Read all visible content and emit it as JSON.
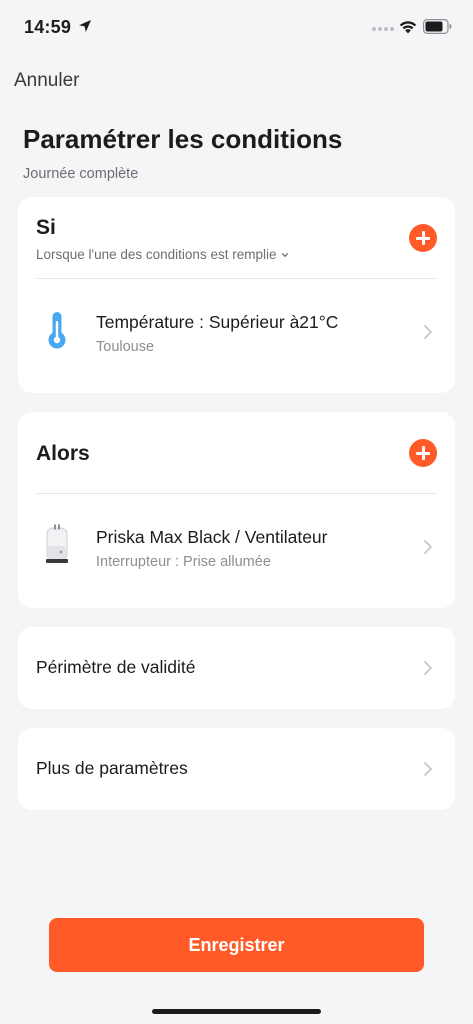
{
  "status_bar": {
    "time": "14:59",
    "icons": [
      "location-arrow-icon",
      "cellular-signal-icon",
      "wifi-icon",
      "battery-icon"
    ]
  },
  "nav": {
    "cancel_label": "Annuler"
  },
  "header": {
    "title": "Paramétrer les conditions",
    "subtitle": "Journée complète"
  },
  "if_section": {
    "title": "Si",
    "mode_label": "Lorsque l'une des conditions est remplie",
    "add_icon": "plus-circle-icon",
    "conditions": [
      {
        "title": "Température : Supérieur à21°C",
        "subtitle": "Toulouse",
        "icon": "thermometer-icon"
      }
    ]
  },
  "then_section": {
    "title": "Alors",
    "add_icon": "plus-circle-icon",
    "actions": [
      {
        "title": "Priska Max Black / Ventilateur",
        "subtitle": "Interrupteur : Prise allumée",
        "icon": "smart-plug-icon"
      }
    ]
  },
  "settings": {
    "validity_label": "Périmètre de validité",
    "more_label": "Plus de paramètres"
  },
  "footer": {
    "save_label": "Enregistrer"
  },
  "colors": {
    "accent": "#ff5a28",
    "background": "#f5f5f7",
    "card": "#ffffff",
    "thermometer": "#4aa8f0"
  }
}
